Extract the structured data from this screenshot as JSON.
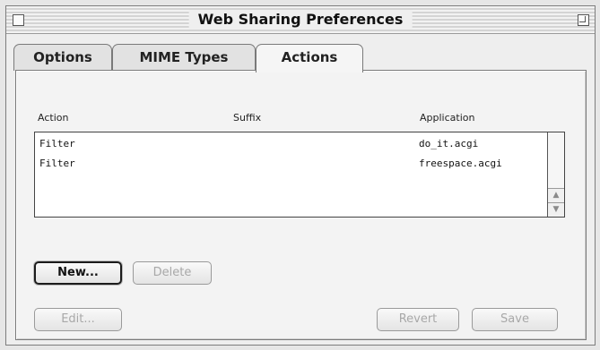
{
  "window": {
    "title": "Web Sharing Preferences"
  },
  "tabs": [
    {
      "label": "Options"
    },
    {
      "label": "MIME Types"
    },
    {
      "label": "Actions",
      "active": true
    }
  ],
  "table": {
    "headers": {
      "action": "Action",
      "suffix": "Suffix",
      "application": "Application"
    },
    "rows": [
      {
        "action": "Filter",
        "suffix": "",
        "application": "do_it.acgi"
      },
      {
        "action": "Filter",
        "suffix": "",
        "application": "freespace.acgi"
      }
    ]
  },
  "buttons": {
    "new": "New...",
    "delete": "Delete",
    "edit": "Edit...",
    "revert": "Revert",
    "save": "Save"
  },
  "scroll": {
    "up_icon": "triangle-up",
    "down_icon": "triangle-down"
  }
}
